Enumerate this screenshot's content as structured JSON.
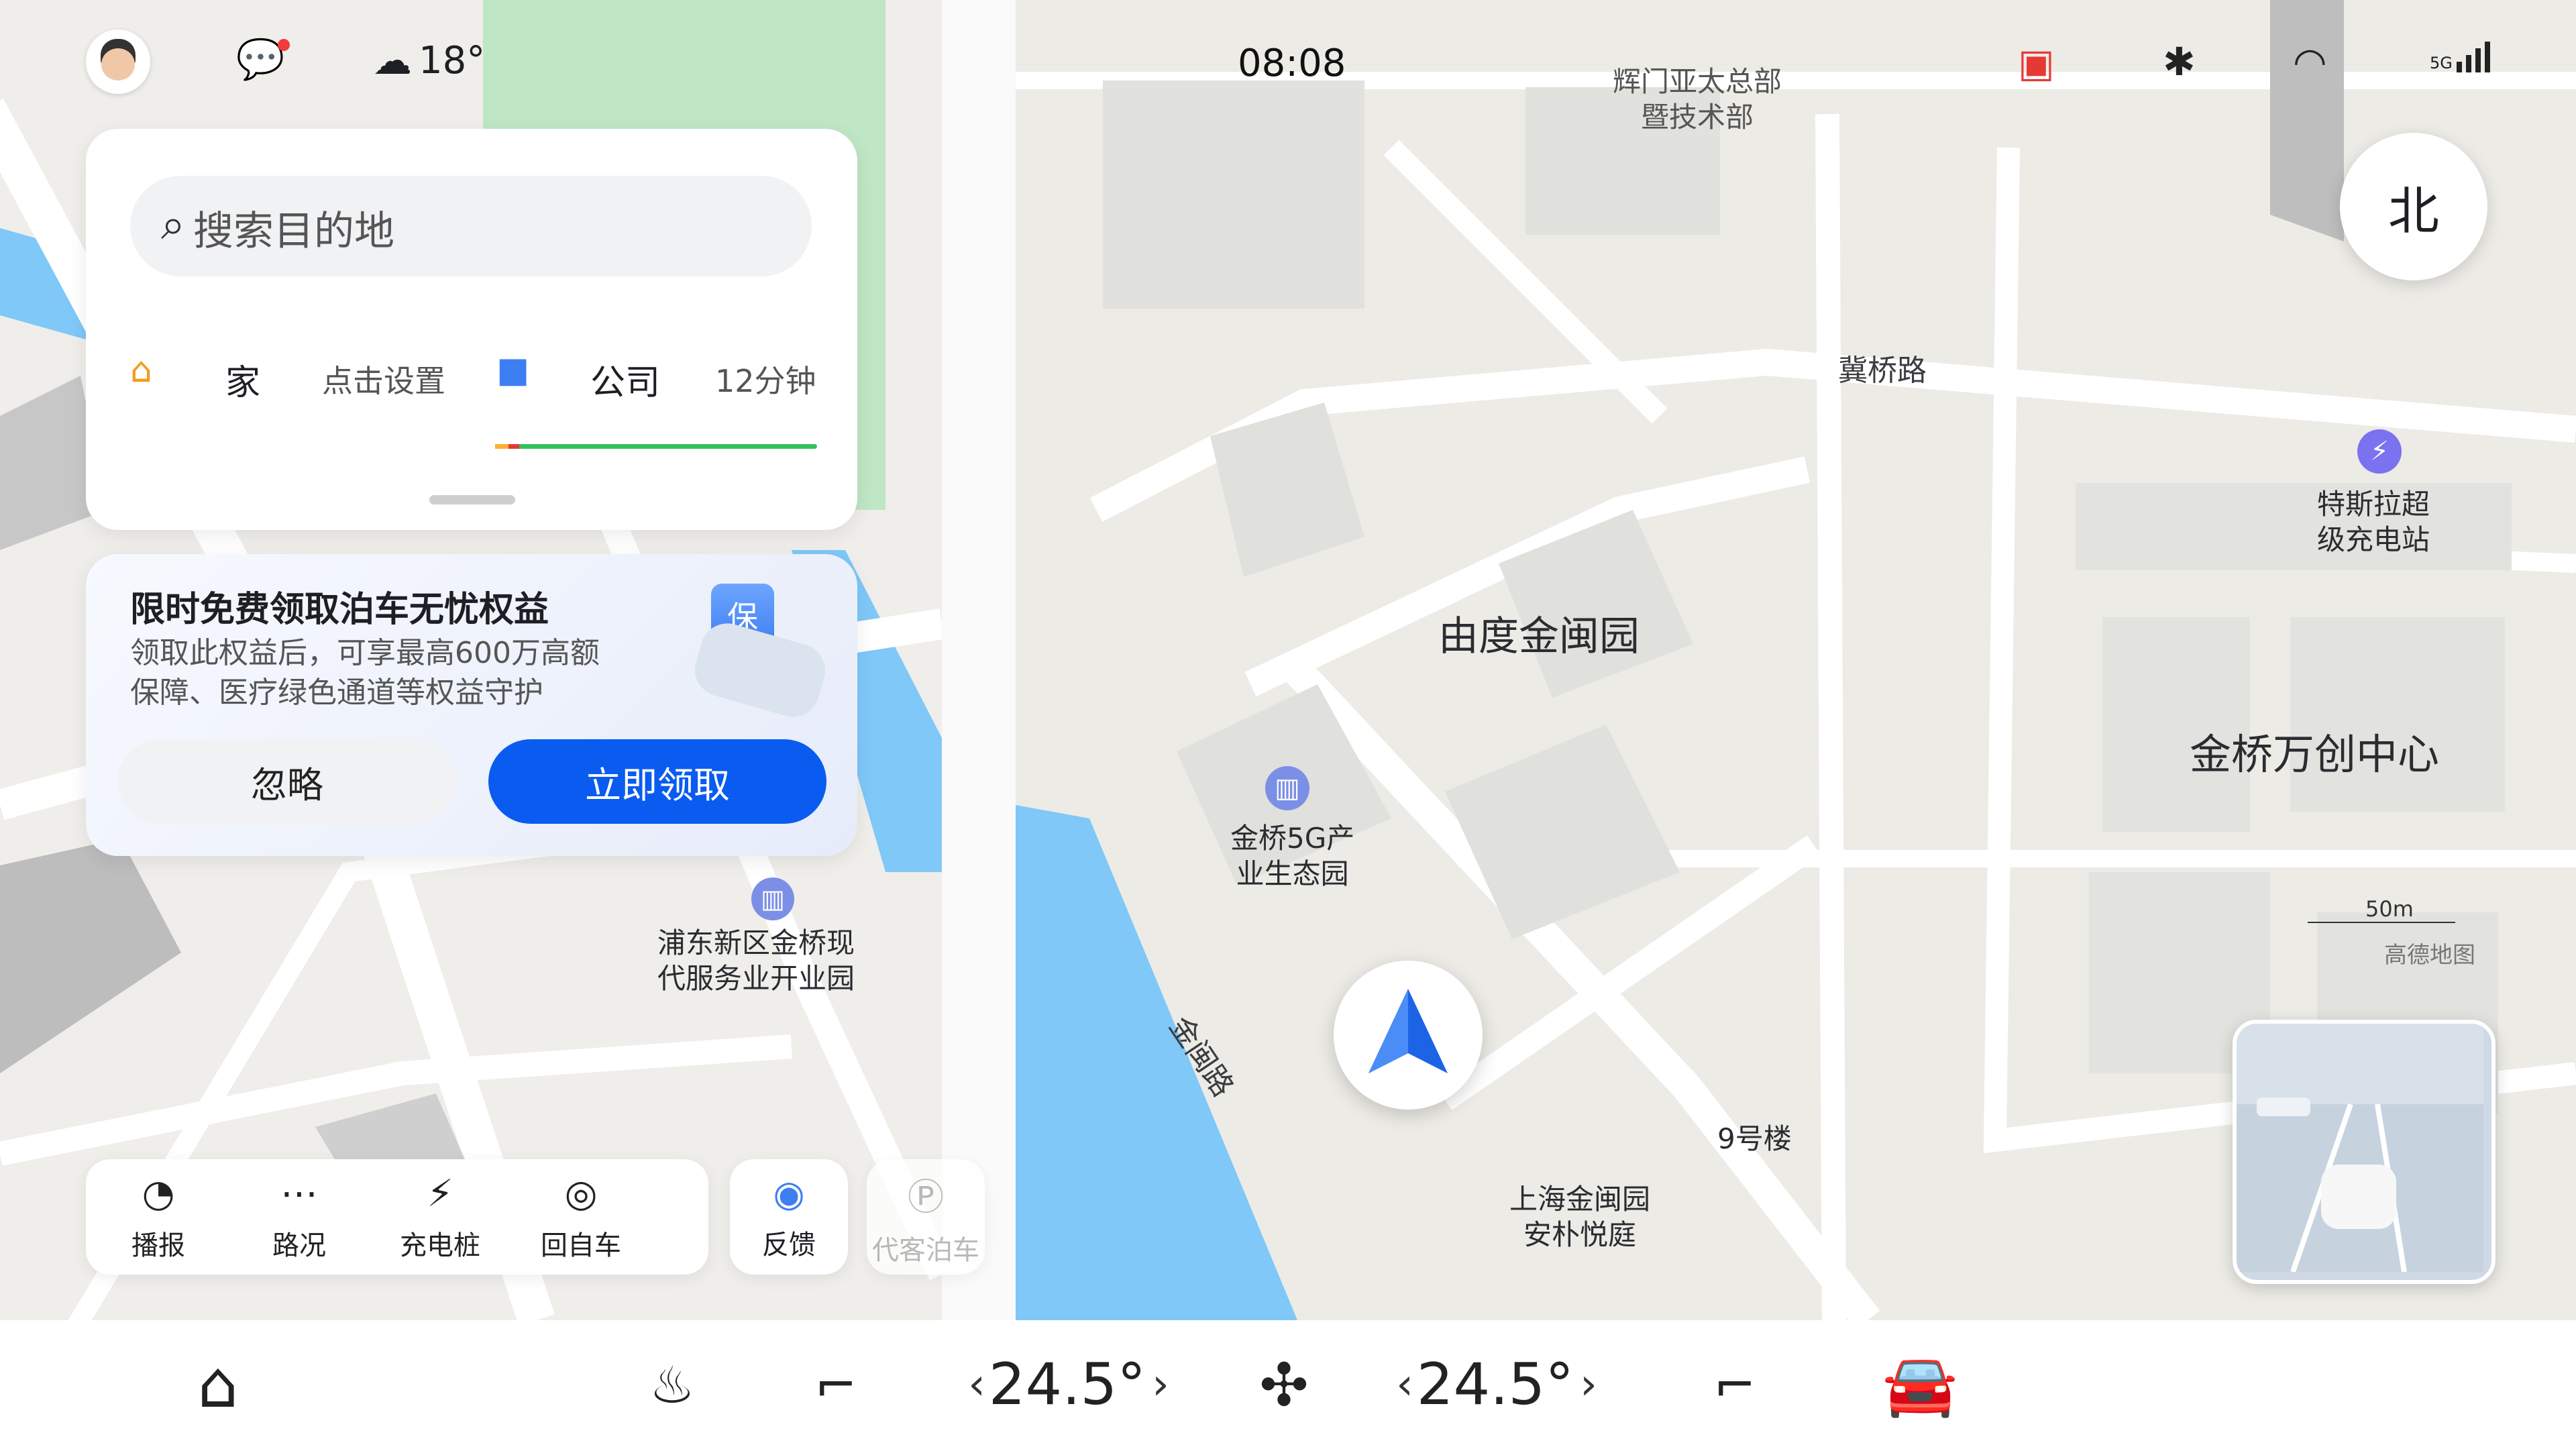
{
  "status_bar": {
    "weather_temp": "18°",
    "clock": "08:08",
    "signal_label": "5G"
  },
  "search": {
    "placeholder": "搜索目的地",
    "home_label": "家",
    "home_action": "点击设置",
    "work_label": "公司",
    "work_eta": "12分钟"
  },
  "promo": {
    "title": "限时免费领取泊车无忧权益",
    "body": "领取此权益后，可享最高600万高额\n保障、医疗绿色通道等权益守护",
    "shield_char": "保",
    "ignore_label": "忽略",
    "claim_label": "立即领取"
  },
  "map_left_labels": {
    "poi": "浦东新区金桥现\n代服务业开业园"
  },
  "tools": [
    {
      "label": "播报",
      "icon": "voice-broadcast-icon"
    },
    {
      "label": "路况",
      "icon": "traffic-icon"
    },
    {
      "label": "充电桩",
      "icon": "charging-pile-icon"
    },
    {
      "label": "回自车",
      "icon": "locate-car-icon"
    }
  ],
  "feedback_label": "反馈",
  "valet_label": "代客泊车",
  "map_right_labels": {
    "company": "辉门亚太总部\n暨技术部",
    "road_jiqiao": "冀桥路",
    "tesla": "特斯拉超\n级充电站",
    "park_jinmin": "由度金闽园",
    "center": "金桥万创中心",
    "park_5g": "金桥5G产\n业生态园",
    "road_jinmin": "金闽路",
    "building9": "9号楼",
    "anpu": "上海金闽园\n安朴悦庭",
    "scale": "50m",
    "provider": "高德地图"
  },
  "compass": {
    "label": "北"
  },
  "dock": {
    "left_temp": "24.5°",
    "right_temp": "24.5°"
  },
  "colors": {
    "accent_blue": "#0a5cf0",
    "water": "#7fc8f8",
    "green_area": "#bfe6c5",
    "road": "#ffffff"
  }
}
